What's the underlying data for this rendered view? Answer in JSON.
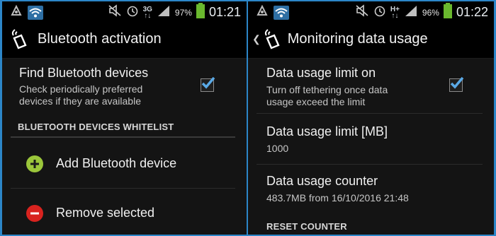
{
  "left": {
    "status": {
      "net": "3G",
      "net_sub": "↑↓",
      "battery": "97%",
      "time": "01:21"
    },
    "title": "Bluetooth activation",
    "find": {
      "title": "Find Bluetooth devices",
      "subtitle_line1": "Check periodically preferred",
      "subtitle_line2": "devices if they are available"
    },
    "section": "BLUETOOTH DEVICES WHITELIST",
    "add_label": "Add Bluetooth device",
    "remove_label": "Remove selected"
  },
  "right": {
    "status": {
      "net": "H+",
      "net_sub": "↑↓",
      "battery": "96%",
      "time": "01:22"
    },
    "title": "Monitoring data usage",
    "limit_on": {
      "title": "Data usage limit on",
      "subtitle_line1": "Turn off tethering once data",
      "subtitle_line2": "usage exceed the limit"
    },
    "limit_mb": {
      "title": "Data usage limit [MB]",
      "value": "1000"
    },
    "counter": {
      "title": "Data usage counter",
      "value": "483.7MB from 16/10/2016 21:48"
    },
    "reset": "RESET COUNTER"
  },
  "colors": {
    "accent": "#2c86c8",
    "check": "#5aa9e6",
    "add": "#9bc63b",
    "remove": "#d8231f"
  },
  "icons": [
    "usb-debug-icon",
    "wifi-icon",
    "mute-icon",
    "alarm-icon",
    "signal-icon",
    "battery-icon",
    "app-tethering-icon",
    "back-chevron-icon",
    "checkmark-icon",
    "plus-icon",
    "minus-icon"
  ]
}
